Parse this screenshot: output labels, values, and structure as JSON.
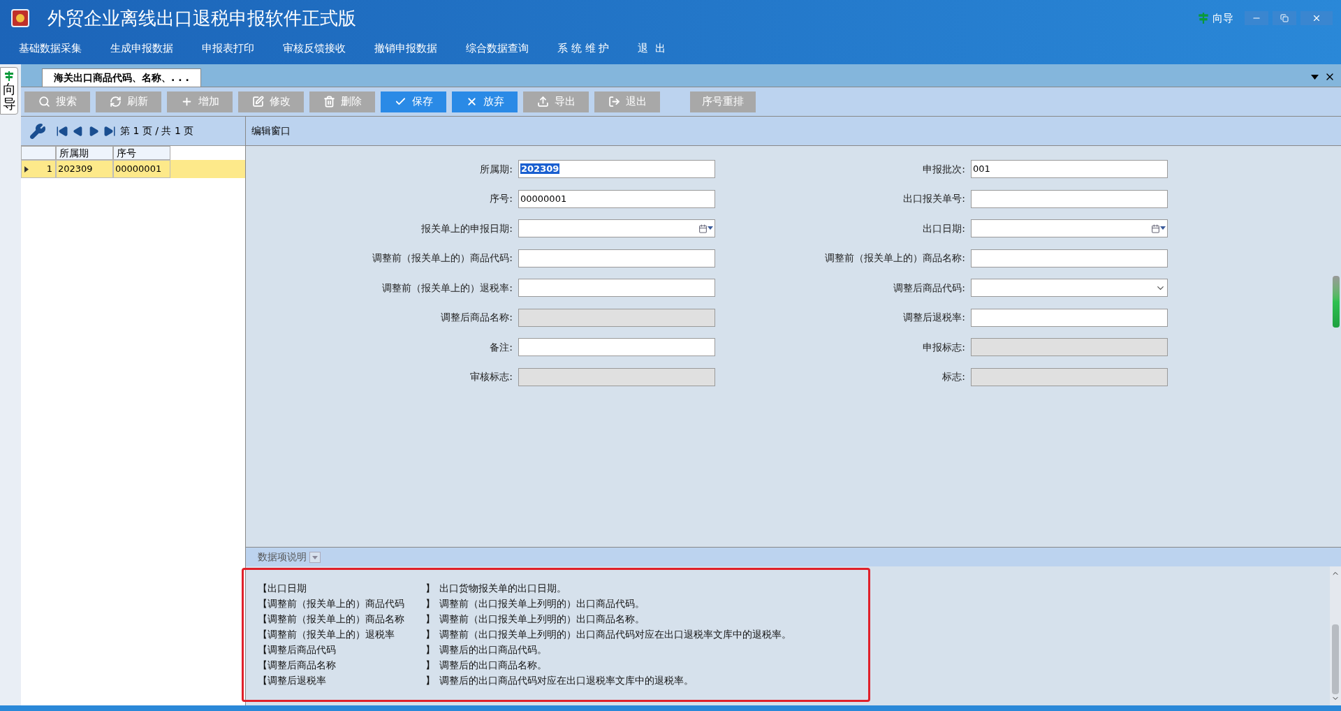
{
  "window": {
    "title": "外贸企业离线出口退税申报软件正式版",
    "guide": "向导"
  },
  "menu": [
    "基础数据采集",
    "生成申报数据",
    "申报表打印",
    "审核反馈接收",
    "撤销申报数据",
    "综合数据查询",
    "系 统 维 护",
    "退  出"
  ],
  "side_tab": "向导",
  "tabs": [
    {
      "label": "海关出口商品代码、名称、. . .",
      "selected": true
    }
  ],
  "toolbar": [
    {
      "label": "搜索",
      "disabled": true
    },
    {
      "label": "刷新",
      "disabled": true
    },
    {
      "label": "增加",
      "disabled": true
    },
    {
      "label": "修改",
      "disabled": true
    },
    {
      "label": "删除",
      "disabled": true
    },
    {
      "label": "保存",
      "disabled": false
    },
    {
      "label": "放弃",
      "disabled": false
    },
    {
      "label": "导出",
      "disabled": true
    },
    {
      "label": "退出",
      "disabled": true
    },
    {
      "label": "序号重排",
      "disabled": true
    }
  ],
  "pager": {
    "text": "第 1 页 / 共 1 页"
  },
  "grid": {
    "columns": [
      "所属期",
      "序号"
    ],
    "rows": [
      {
        "index": "1",
        "cells": [
          "202309",
          "00000001"
        ],
        "selected": true
      }
    ]
  },
  "edit_window": {
    "title": "编辑窗口",
    "fields_left": [
      {
        "label": "所属期:",
        "value": "202309",
        "kind": "text",
        "disabled": false,
        "value_selected": true
      },
      {
        "label": "序号:",
        "value": "00000001",
        "kind": "text",
        "disabled": false,
        "value_selected": false
      },
      {
        "label": "报关单上的申报日期:",
        "kind": "date",
        "disabled": false
      },
      {
        "label": "调整前（报关单上的）商品代码:",
        "kind": "text",
        "disabled": false
      },
      {
        "label": "调整前（报关单上的）退税率:",
        "kind": "text",
        "disabled": false
      },
      {
        "label": "调整后商品名称:",
        "kind": "text",
        "disabled": true
      },
      {
        "label": "备注:",
        "kind": "text",
        "disabled": false
      },
      {
        "label": "审核标志:",
        "kind": "text",
        "disabled": true
      }
    ],
    "fields_right": [
      {
        "label": "申报批次:",
        "value": "001",
        "kind": "text",
        "disabled": false,
        "value_selected": false
      },
      {
        "label": "出口报关单号:",
        "kind": "text",
        "disabled": false
      },
      {
        "label": "出口日期:",
        "kind": "date",
        "disabled": false
      },
      {
        "label": "调整前（报关单上的）商品名称:",
        "kind": "text",
        "disabled": false
      },
      {
        "label": "调整后商品代码:",
        "kind": "select",
        "disabled": false
      },
      {
        "label": "调整后退税率:",
        "kind": "text",
        "disabled": false
      },
      {
        "label": "申报标志:",
        "kind": "text",
        "disabled": true
      },
      {
        "label": "标志:",
        "kind": "text",
        "disabled": true
      }
    ]
  },
  "description": {
    "title": "数据项说明",
    "rows": [
      {
        "term": "【出口日期",
        "close": "】",
        "text": "出口货物报关单的出口日期。"
      },
      {
        "term": "【调整前（报关单上的）商品代码",
        "close": "】",
        "text": "调整前（出口报关单上列明的）出口商品代码。"
      },
      {
        "term": "【调整前（报关单上的）商品名称",
        "close": "】",
        "text": "调整前（出口报关单上列明的）出口商品名称。"
      },
      {
        "term": "【调整前（报关单上的）退税率",
        "close": "】",
        "text": "调整前（出口报关单上列明的）出口商品代码对应在出口退税率文库中的退税率。"
      },
      {
        "term": "【调整后商品代码",
        "close": "】",
        "text": "调整后的出口商品代码。"
      },
      {
        "term": "【调整后商品名称",
        "close": "】",
        "text": "调整后的出口商品名称。"
      },
      {
        "term": "【调整后退税率",
        "close": "】",
        "text": "调整后的出口商品代码对应在出口退税率文库中的退税率。"
      }
    ]
  }
}
